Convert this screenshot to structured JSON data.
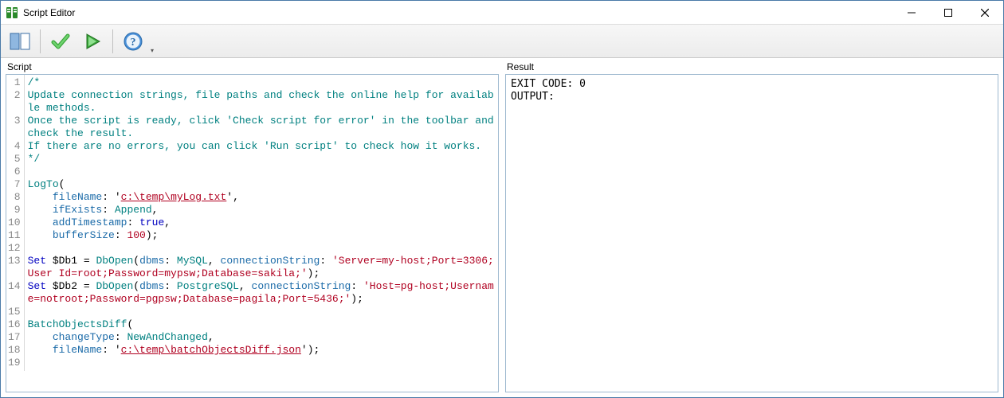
{
  "window": {
    "title": "Script Editor"
  },
  "toolbar": {
    "buttons": {
      "panels": "Toggle panels",
      "check": "Check script for error",
      "run": "Run script",
      "help": "Help"
    }
  },
  "panes": {
    "script_label": "Script",
    "result_label": "Result"
  },
  "result": {
    "exit_line": "EXIT CODE: 0",
    "output_line": "OUTPUT:"
  },
  "script": {
    "lines": [
      {
        "n": 1,
        "raw": "/*",
        "kind": "comment"
      },
      {
        "n": 2,
        "raw": "Update connection strings, file paths and check the online help for available methods.",
        "kind": "comment"
      },
      {
        "n": 3,
        "raw": "Once the script is ready, click 'Check script for error' in the toolbar and check the result.",
        "kind": "comment"
      },
      {
        "n": 4,
        "raw": "If there are no errors, you can click 'Run script' to check how it works.",
        "kind": "comment"
      },
      {
        "n": 5,
        "raw": "*/",
        "kind": "comment"
      },
      {
        "n": 6,
        "raw": "",
        "kind": "blank"
      },
      {
        "n": 7,
        "raw": "LogTo(",
        "kind": "code"
      },
      {
        "n": 8,
        "raw": "    fileName: 'c:\\temp\\myLog.txt',",
        "kind": "code"
      },
      {
        "n": 9,
        "raw": "    ifExists: Append,",
        "kind": "code"
      },
      {
        "n": 10,
        "raw": "    addTimestamp: true,",
        "kind": "code"
      },
      {
        "n": 11,
        "raw": "    bufferSize: 100);",
        "kind": "code"
      },
      {
        "n": 12,
        "raw": "",
        "kind": "blank"
      },
      {
        "n": 13,
        "raw": "Set $Db1 = DbOpen(dbms: MySQL, connectionString: 'Server=my-host;Port=3306;User Id=root;Password=mypsw;Database=sakila;');",
        "kind": "code"
      },
      {
        "n": 14,
        "raw": "Set $Db2 = DbOpen(dbms: PostgreSQL, connectionString: 'Host=pg-host;Username=notroot;Password=pgpsw;Database=pagila;Port=5436;');",
        "kind": "code"
      },
      {
        "n": 15,
        "raw": "",
        "kind": "blank"
      },
      {
        "n": 16,
        "raw": "BatchObjectsDiff(",
        "kind": "code"
      },
      {
        "n": 17,
        "raw": "    changeType: NewAndChanged,",
        "kind": "code"
      },
      {
        "n": 18,
        "raw": "    fileName: 'c:\\temp\\batchObjectsDiff.json');",
        "kind": "code"
      },
      {
        "n": 19,
        "raw": "",
        "kind": "blank"
      }
    ]
  }
}
